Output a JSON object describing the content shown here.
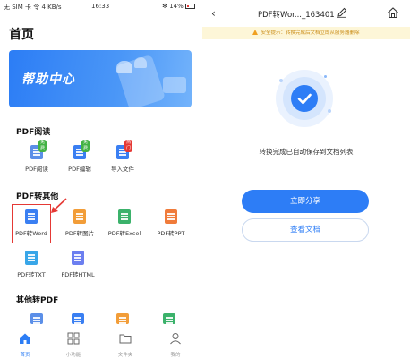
{
  "colors": {
    "accent": "#2d7df6",
    "highlight": "#e53935",
    "notice_bg": "#fdf6d8",
    "notice_text": "#c98a12"
  },
  "left": {
    "status": {
      "carrier": "无 SIM 卡 令 4 KB/s",
      "time": "16:33",
      "battery": "✻ 14%"
    },
    "title": "首页",
    "banner_text": "帮助中心",
    "sections": {
      "pdf_read": {
        "title": "PDF阅读",
        "tools": [
          {
            "label": "PDF阅读",
            "badge": "免费",
            "icon": "pdf-read-icon"
          },
          {
            "label": "PDF编辑",
            "badge": "免费",
            "icon": "pdf-edit-icon"
          },
          {
            "label": "导入文件",
            "badge": "热门",
            "icon": "import-file-icon"
          }
        ]
      },
      "pdf_to_other": {
        "title": "PDF转其他",
        "tools": [
          {
            "label": "PDF转Word",
            "icon": "word-file-icon"
          },
          {
            "label": "PDF转图片",
            "icon": "image-file-icon"
          },
          {
            "label": "PDF转Excel",
            "icon": "excel-file-icon"
          },
          {
            "label": "PDF转PPT",
            "icon": "ppt-file-icon"
          },
          {
            "label": "PDF转TXT",
            "icon": "txt-file-icon"
          },
          {
            "label": "PDF转HTML",
            "icon": "html-file-icon"
          }
        ]
      },
      "other_to_pdf": {
        "title": "其他转PDF"
      }
    },
    "tabs": [
      {
        "label": "首页",
        "icon": "home-icon",
        "active": true
      },
      {
        "label": "小功能",
        "icon": "grid-icon"
      },
      {
        "label": "文件夹",
        "icon": "folder-icon"
      },
      {
        "label": "我的",
        "icon": "user-icon"
      }
    ]
  },
  "right": {
    "back": "‹",
    "title": "PDF转Wor..._163401",
    "notice": "安全提示：转换完成后文档立即从服务器删除",
    "done_text": "转换完成已自动保存到文档列表",
    "share_label": "立即分享",
    "view_label": "查看文档"
  }
}
